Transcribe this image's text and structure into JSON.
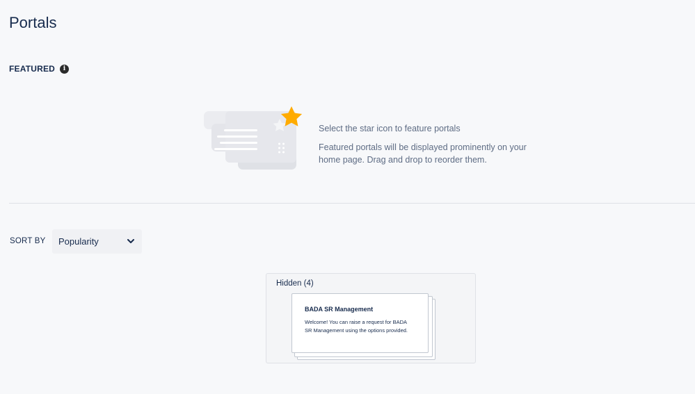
{
  "page": {
    "title": "Portals"
  },
  "featured": {
    "heading": "FEATURED",
    "info_icon": "info-icon",
    "empty_title": "Select the star icon to feature portals",
    "empty_body": "Featured portals will be displayed prominently on your home page. Drag and drop to reorder them.",
    "star_color": "#ffab00"
  },
  "sort": {
    "label": "SORT BY",
    "selected": "Popularity",
    "icon": "chevron-down-icon"
  },
  "hidden": {
    "label": "Hidden (4)",
    "card": {
      "title": "BADA SR Management",
      "description": "Welcome! You can raise a request for BADA SR Management using the options provided."
    }
  }
}
